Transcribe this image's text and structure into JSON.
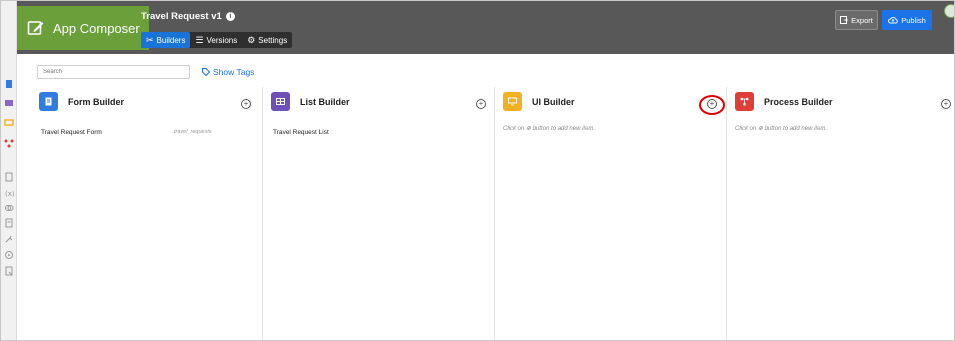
{
  "header": {
    "brand": "App Composer",
    "app_title": "Travel Request v1",
    "tabs": [
      {
        "label": "Builders",
        "active": true
      },
      {
        "label": "Versions",
        "active": false
      },
      {
        "label": "Settings",
        "active": false
      }
    ],
    "export_label": "Export",
    "publish_label": "Publish"
  },
  "toolbar": {
    "search_placeholder": "Search",
    "show_tags": "Show Tags"
  },
  "columns": [
    {
      "title": "Form Builder",
      "icon": "form-icon",
      "color": "#2f7de1",
      "items": [
        {
          "label": "Travel Request Form",
          "tag": "travel_requests"
        }
      ],
      "hint": ""
    },
    {
      "title": "List Builder",
      "icon": "list-icon",
      "color": "#6f4fb8",
      "items": [
        {
          "label": "Travel Request List",
          "tag": ""
        }
      ],
      "hint": ""
    },
    {
      "title": "UI Builder",
      "icon": "monitor-icon",
      "color": "#f2b122",
      "items": [],
      "hint": "Click on ⊕ button to add new item."
    },
    {
      "title": "Process Builder",
      "icon": "process-icon",
      "color": "#df3e36",
      "items": [],
      "hint": "Click on ⊕ button to add new item."
    }
  ],
  "colors": {
    "topbar": "#585858",
    "brand": "#6a9f3a",
    "accent": "#1a73e8",
    "highlight": "#e00000"
  }
}
